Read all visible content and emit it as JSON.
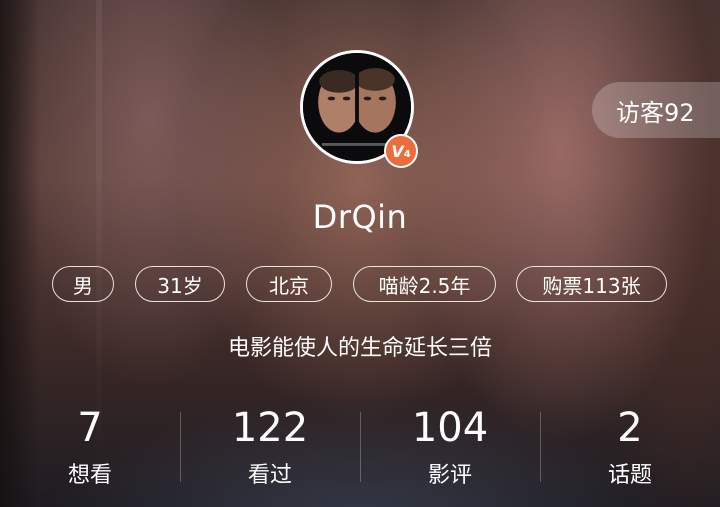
{
  "profile": {
    "username": "DrQin",
    "level_badge": "V",
    "level_number": "4",
    "visitors_label": "访客92",
    "signature": "电影能使人的生命延长三倍"
  },
  "tags": [
    "男",
    "31岁",
    "北京",
    "喵龄2.5年",
    "购票113张"
  ],
  "stats": [
    {
      "value": "7",
      "label": "想看"
    },
    {
      "value": "122",
      "label": "看过"
    },
    {
      "value": "104",
      "label": "影评"
    },
    {
      "value": "2",
      "label": "话题"
    }
  ],
  "icons": {
    "avatar": "face-off-poster-avatar",
    "badge": "vip-level-badge"
  },
  "colors": {
    "badge": "#ec6c3c"
  }
}
